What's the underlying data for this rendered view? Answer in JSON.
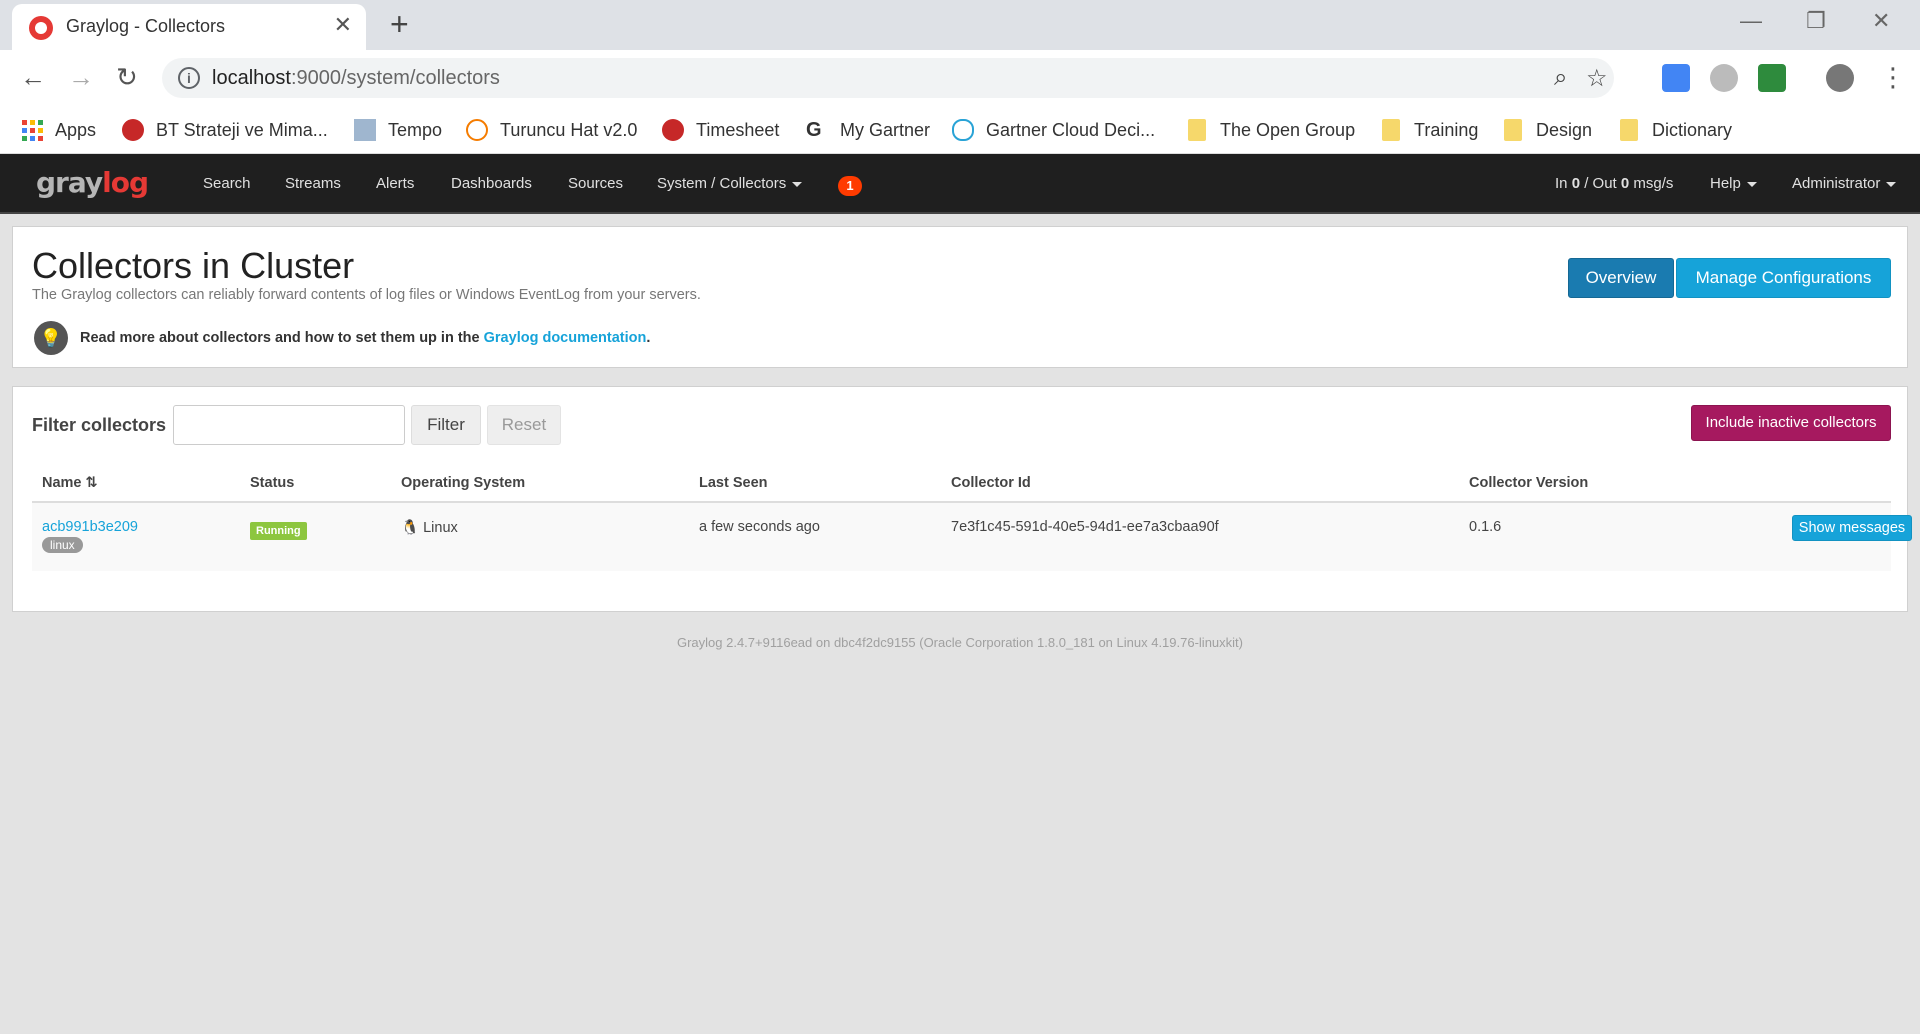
{
  "browser": {
    "tab_title": "Graylog - Collectors",
    "url_host": "localhost",
    "url_rest": ":9000/system/collectors",
    "bookmarks": [
      {
        "label": "Apps"
      },
      {
        "label": "BT Strateji ve Mima..."
      },
      {
        "label": "Tempo"
      },
      {
        "label": "Turuncu Hat v2.0"
      },
      {
        "label": "Timesheet"
      },
      {
        "label": "My Gartner"
      },
      {
        "label": "Gartner Cloud Deci..."
      },
      {
        "label": "The Open Group"
      },
      {
        "label": "Training"
      },
      {
        "label": "Design"
      },
      {
        "label": "Dictionary"
      }
    ]
  },
  "nav": {
    "logo_gray": "gray",
    "logo_red": "log",
    "items": [
      "Search",
      "Streams",
      "Alerts",
      "Dashboards",
      "Sources",
      "System / Collectors"
    ],
    "notification_count": "1",
    "throughput": {
      "in_label": "In",
      "in_value": "0",
      "out_label": "/ Out",
      "out_value": "0",
      "unit": "msg/s"
    },
    "help": "Help",
    "user": "Administrator"
  },
  "header": {
    "title": "Collectors in Cluster",
    "subtitle": "The Graylog collectors can reliably forward contents of log files or Windows EventLog from your servers.",
    "doc_text": "Read more about collectors and how to set them up in the",
    "doc_link": "Graylog documentation",
    "doc_end": ".",
    "btn_overview": "Overview",
    "btn_manage": "Manage Configurations"
  },
  "filter": {
    "label": "Filter collectors",
    "input_value": "",
    "btn_filter": "Filter",
    "btn_reset": "Reset",
    "btn_inactive": "Include inactive collectors"
  },
  "table": {
    "columns": [
      "Name",
      "Status",
      "Operating System",
      "Last Seen",
      "Collector Id",
      "Collector Version"
    ],
    "rows": [
      {
        "name": "acb991b3e209",
        "tag": "linux",
        "status": "Running",
        "os": "Linux",
        "last_seen": "a few seconds ago",
        "collector_id": "7e3f1c45-591d-40e5-94d1-ee7a3cbaa90f",
        "version": "0.1.6",
        "action": "Show messages"
      }
    ]
  },
  "footer": "Graylog 2.4.7+9116ead on dbc4f2dc9155 (Oracle Corporation 1.8.0_181 on Linux 4.19.76-linuxkit)",
  "colors": {
    "nav_bg": "#1f1f1f",
    "primary": "#1a7bb0",
    "info": "#16a3d9",
    "inactive_btn": "#a6195f",
    "running": "#8dc63f"
  }
}
